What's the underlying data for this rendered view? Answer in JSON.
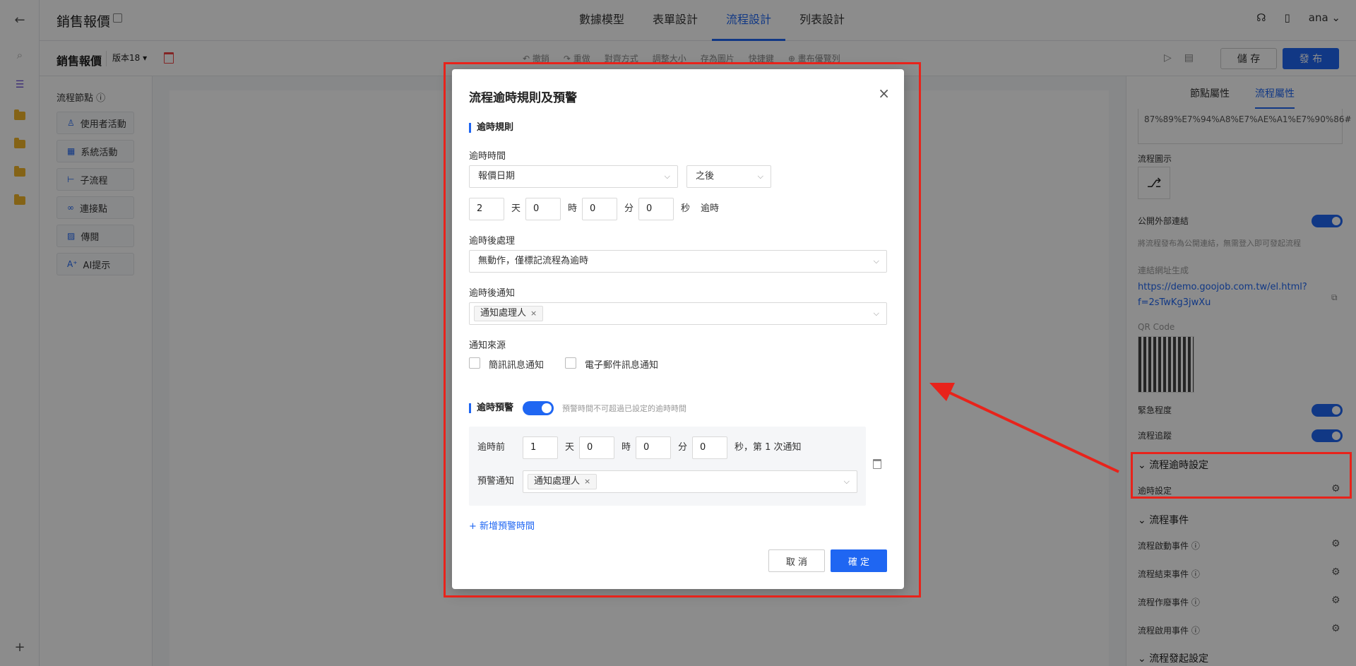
{
  "app": {
    "title": "銷售報價",
    "nav_tabs": [
      "數據模型",
      "表單設計",
      "流程設計",
      "列表設計"
    ],
    "user": "ana"
  },
  "subbar": {
    "title": "銷售報價",
    "version": "版本18 ▾",
    "toolbar": [
      "↶ 撤銷",
      "↷ 重做",
      "對齊方式",
      "調整大小",
      "存為圖片",
      "快捷鍵",
      "⊕ 畫布優覽列"
    ],
    "save_label": "儲 存",
    "publish_label": "發 布"
  },
  "node_panel": {
    "title": "流程節點 ⓘ",
    "items": [
      "使用者活動",
      "系統活動",
      "子流程",
      "連接點",
      "傳閱",
      "AI提示"
    ]
  },
  "prop_panel": {
    "tabs": [
      "節點屬性",
      "流程屬性"
    ],
    "url_fragment": "87%89%E7%94%A8%E7%AE%A1%E7%90%86#",
    "flow_icon_label": "流程圖示",
    "public_link_label": "公開外部連結",
    "public_link_hint": "將流程發布為公開連結，無需登入即可發起流程",
    "link_gen_label": "連結網址生成",
    "link_url": "https://demo.goojob.com.tw/el.html?f=2sTwKg3jwXu",
    "qr_label": "QR Code",
    "urgency_label": "緊急程度",
    "tracking_label": "流程追蹤",
    "timeout_section": "流程逾時設定",
    "timeout_setting": "逾時設定",
    "events_section": "流程事件",
    "events": [
      "流程啟動事件 ⓘ",
      "流程結束事件 ⓘ",
      "流程作廢事件 ⓘ",
      "流程啟用事件 ⓘ"
    ],
    "launch_section": "流程發起設定"
  },
  "modal": {
    "title": "流程逾時規則及預警",
    "close": "×",
    "rule_section": "逾時規則",
    "time_label": "逾時時間",
    "base_field": "報價日期",
    "relation": "之後",
    "days": "2",
    "day_unit": "天",
    "hours": "0",
    "hour_unit": "時",
    "minutes": "0",
    "minute_unit": "分",
    "seconds": "0",
    "second_unit": "秒",
    "timeout_suffix": "逾時",
    "after_action_label": "逾時後處理",
    "after_action_value": "無動作，僅標記流程為逾時",
    "after_notify_label": "逾時後通知",
    "after_notify_tag": "通知處理人",
    "source_label": "通知來源",
    "source_sms": "簡訊訊息通知",
    "source_email": "電子郵件訊息通知",
    "warn_section": "逾時預警",
    "warn_hint": "預警時間不可超過已設定的逾時時間",
    "warn_before_label": "逾時前",
    "warn_days": "1",
    "warn_hours": "0",
    "warn_minutes": "0",
    "warn_seconds": "0",
    "warn_suffix": "秒，第 1 次通知",
    "warn_notify_label": "預警通知",
    "warn_notify_tag": "通知處理人",
    "add_warn": "+ 新增預警時間",
    "cancel": "取 消",
    "ok": "確 定"
  }
}
